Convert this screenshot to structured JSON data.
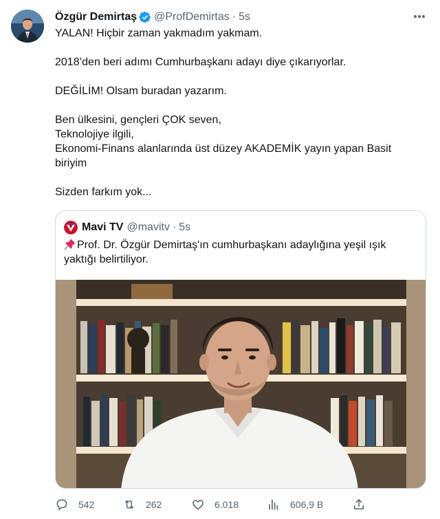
{
  "author": {
    "display_name": "Özgür Demirtaş",
    "handle": "@ProfDemirtas",
    "separator": "·",
    "time": "5s",
    "verified": true,
    "avatar_icon": "profile-avatar"
  },
  "tweet": {
    "lines": [
      "YALAN! Hiçbir zaman yakmadım yakmam.",
      "2018’den beri adımı Cumhurbaşkanı adayı diye çıkarıyorlar.",
      "DEĞİLİM! Olsam buradan yazarım.",
      "Ben ülkesini, gençleri ÇOK seven,",
      "Teknolojiye ilgili,",
      "Ekonomi-Finans alanlarında üst düzey AKADEMİK yayın yapan Basit",
      "biriyim",
      "Sizden farkım yok..."
    ]
  },
  "quoted": {
    "display_name": "Mavi TV",
    "handle": "@mavitv",
    "separator": "·",
    "time": "5s",
    "text_line1": "Prof. Dr. Özgür Demirtaş'ın cumhurbaşkanı adaylığına yeşil ışık",
    "text_line2": "yaktığı belirtiliyor.",
    "pin_icon": "pushpin-icon",
    "media": "photo of man in white shirt in front of bookshelf"
  },
  "actions": {
    "replies": "542",
    "retweets": "262",
    "likes": "6.018",
    "views": "606,9 B"
  },
  "colors": {
    "text": "#0f1419",
    "secondary": "#536471",
    "verified": "#1d9bf0",
    "border": "#cfd9de"
  }
}
